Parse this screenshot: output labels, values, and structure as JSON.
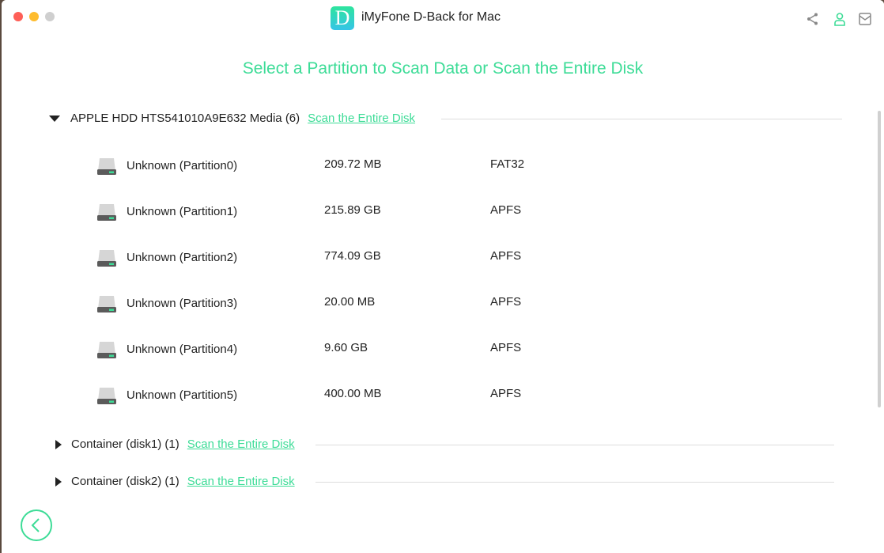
{
  "window": {
    "title": "iMyFone D-Back for Mac",
    "logo_letter": "D"
  },
  "toolbar": {
    "icons": [
      "share-icon",
      "user-icon",
      "mail-icon"
    ]
  },
  "heading": "Select a Partition to Scan Data or Scan the Entire Disk",
  "disks": [
    {
      "label": "APPLE HDD HTS541010A9E632 Media (6)",
      "expanded": true,
      "link": "Scan the Entire Disk",
      "partitions": [
        {
          "name": "Unknown (Partition0)",
          "size": "209.72 MB",
          "fs": "FAT32"
        },
        {
          "name": "Unknown (Partition1)",
          "size": "215.89 GB",
          "fs": "APFS"
        },
        {
          "name": "Unknown (Partition2)",
          "size": "774.09 GB",
          "fs": "APFS"
        },
        {
          "name": "Unknown (Partition3)",
          "size": "20.00 MB",
          "fs": "APFS"
        },
        {
          "name": "Unknown (Partition4)",
          "size": "9.60 GB",
          "fs": "APFS"
        },
        {
          "name": "Unknown (Partition5)",
          "size": "400.00 MB",
          "fs": "APFS"
        }
      ]
    },
    {
      "label": "Container (disk1) (1)",
      "expanded": false,
      "link": "Scan the Entire Disk"
    },
    {
      "label": "Container (disk2) (1)",
      "expanded": false,
      "link": "Scan the Entire Disk"
    }
  ],
  "colors": {
    "accent": "#3ddc97"
  }
}
